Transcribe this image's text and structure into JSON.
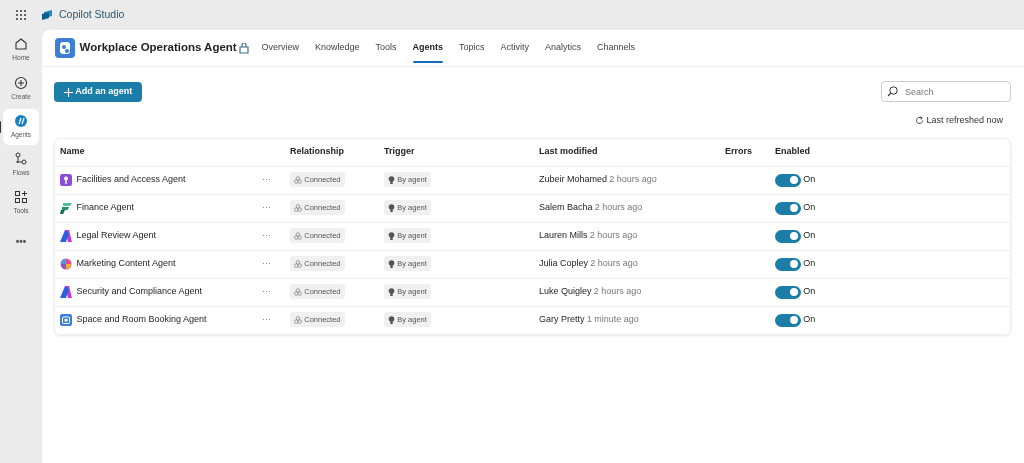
{
  "app": {
    "title": "Copilot Studio"
  },
  "rail": [
    {
      "label": "Home",
      "kind": "home",
      "selected": false
    },
    {
      "label": "Create",
      "kind": "create",
      "selected": false
    },
    {
      "label": "Agents",
      "kind": "agents",
      "selected": true
    },
    {
      "label": "Flows",
      "kind": "flows",
      "selected": false
    },
    {
      "label": "Tools",
      "kind": "tools",
      "selected": false
    },
    {
      "label": "•••",
      "kind": "more",
      "selected": false
    }
  ],
  "agent": {
    "title": "Workplace Operations Agent"
  },
  "tabs": [
    {
      "label": "Overview",
      "selected": false
    },
    {
      "label": "Knowledge",
      "selected": false
    },
    {
      "label": "Tools",
      "selected": false
    },
    {
      "label": "Agents",
      "selected": true
    },
    {
      "label": "Topics",
      "selected": false
    },
    {
      "label": "Activity",
      "selected": false
    },
    {
      "label": "Analytics",
      "selected": false
    },
    {
      "label": "Channels",
      "selected": false
    }
  ],
  "add_button": "Add an agent",
  "search": {
    "placeholder": "Search"
  },
  "refresh": "Last refreshed now",
  "table": {
    "columns": [
      "Name",
      "Relationship",
      "Trigger",
      "Last modified",
      "Errors",
      "Enabled"
    ],
    "rows": [
      {
        "kind": "key",
        "name": "Facilities and Access Agent",
        "menu": "···",
        "relationship": "Connected",
        "trigger": "By agent",
        "modified_by": "Zubeir Mohamed",
        "modified_when": "2 hours ago",
        "on": true,
        "state": "On"
      },
      {
        "kind": "finance",
        "name": "Finance Agent",
        "menu": "···",
        "relationship": "Connected",
        "trigger": "By agent",
        "modified_by": "Salem Bacha",
        "modified_when": "2 hours ago",
        "on": true,
        "state": "On"
      },
      {
        "kind": "legal",
        "name": "Legal Review Agent",
        "menu": "···",
        "relationship": "Connected",
        "trigger": "By agent",
        "modified_by": "Lauren Mills",
        "modified_when": "2 hours ago",
        "on": true,
        "state": "On"
      },
      {
        "kind": "marketing",
        "name": "Marketing Content Agent",
        "menu": "···",
        "relationship": "Connected",
        "trigger": "By agent",
        "modified_by": "Julia Copley",
        "modified_when": "2 hours ago",
        "on": true,
        "state": "On"
      },
      {
        "kind": "legal",
        "name": "Security and Compliance Agent",
        "menu": "···",
        "relationship": "Connected",
        "trigger": "By agent",
        "modified_by": "Luke Quigley",
        "modified_when": "2 hours ago",
        "on": true,
        "state": "On"
      },
      {
        "kind": "booking",
        "name": "Space and Room Booking Agent",
        "menu": "···",
        "relationship": "Connected",
        "trigger": "By agent",
        "modified_by": "Gary Pretty",
        "modified_when": "1 minute ago",
        "on": true,
        "state": "On"
      }
    ]
  }
}
